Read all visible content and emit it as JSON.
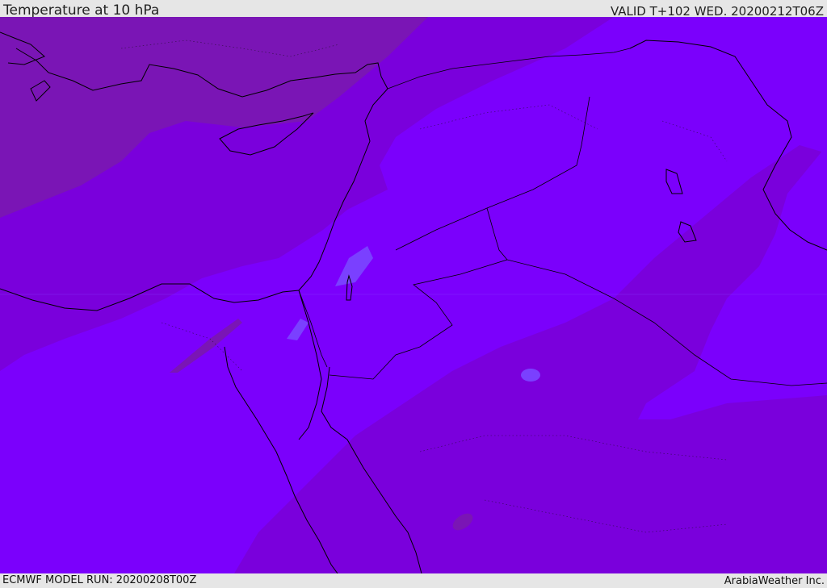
{
  "header": {
    "title": "Temperature at 10 hPa",
    "valid": "VALID T+102 WED. 20200212T06Z"
  },
  "footer": {
    "model_run": "ECMWF MODEL RUN: 20200208T00Z",
    "credit": "ArabiaWeather Inc."
  },
  "map": {
    "colors": {
      "warm": "#7a15b5",
      "mid": "#7a00dc",
      "cool": "#7b00fc",
      "coldest": "#7a40ff",
      "coast": "#000000"
    }
  }
}
